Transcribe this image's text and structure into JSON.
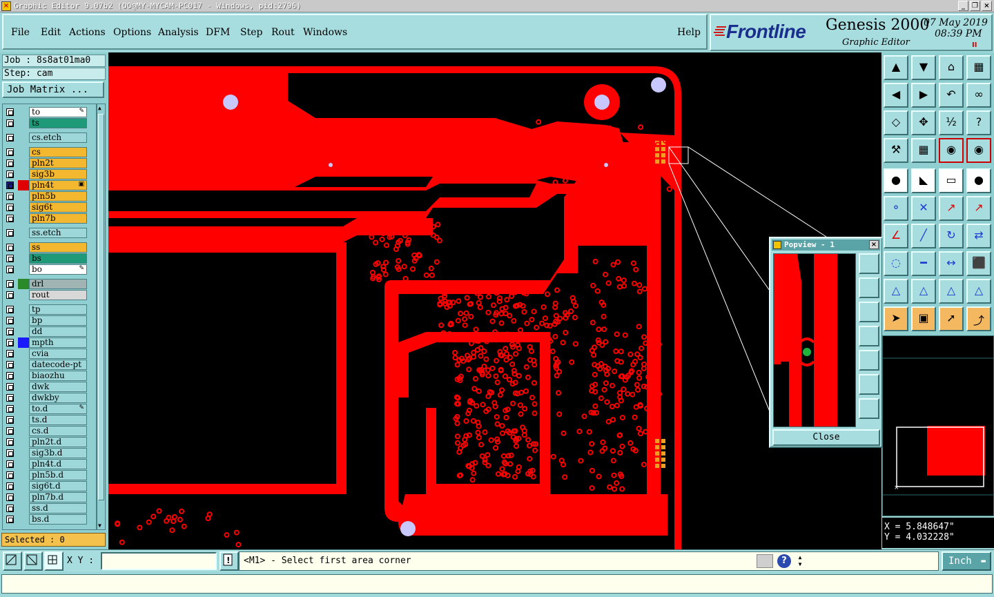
{
  "window": {
    "title": "Graphic Editor 9.07b2 (OO@MY-MYCAM-PC017 - Windows, pid:2796)",
    "min_icon": "minimize-icon",
    "max_icon": "restore-icon",
    "close_icon": "close-icon"
  },
  "menu": {
    "items": [
      {
        "label": "File",
        "key": "F"
      },
      {
        "label": "Edit",
        "key": "E"
      },
      {
        "label": "Actions",
        "key": "A"
      },
      {
        "label": "Options",
        "key": "O"
      },
      {
        "label": "Analysis",
        "key": "n"
      },
      {
        "label": "DFM",
        "key": "D"
      },
      {
        "label": "Step",
        "key": "S"
      },
      {
        "label": "Rout",
        "key": "R"
      },
      {
        "label": "Windows",
        "key": "W"
      }
    ],
    "help": "Help"
  },
  "brand": {
    "logo": "Frontline",
    "product": "Genesis 2000",
    "subtitle": "Graphic Editor",
    "date": "07 May 2019",
    "time": "08:39 PM",
    "pause": "II"
  },
  "job": {
    "job_label": "Job : 8s8at01ma0",
    "step_label": "Step: cam",
    "matrix_button": "Job Matrix ..."
  },
  "layers": [
    {
      "name": "to",
      "color": "#ffffff",
      "swatch": "",
      "mark": "✎",
      "gap_before": false
    },
    {
      "name": "ts",
      "color": "#1e9a78",
      "swatch": "",
      "mark": "",
      "gap_before": false
    },
    {
      "name": "cs.etch",
      "color": "#9ed7d9",
      "swatch": "",
      "mark": "",
      "gap_before": true
    },
    {
      "name": "cs",
      "color": "#f4b830",
      "swatch": "",
      "mark": "",
      "gap_before": true
    },
    {
      "name": "pln2t",
      "color": "#f4b830",
      "swatch": "",
      "mark": "",
      "gap_before": false
    },
    {
      "name": "sig3b",
      "color": "#f4b830",
      "swatch": "",
      "mark": "",
      "gap_before": false
    },
    {
      "name": "pln4t",
      "color": "#f4b830",
      "swatch": "#e00000",
      "mark": "▣",
      "gap_before": false,
      "active": true
    },
    {
      "name": "pln5b",
      "color": "#f4b830",
      "swatch": "",
      "mark": "",
      "gap_before": false
    },
    {
      "name": "sig6t",
      "color": "#f4b830",
      "swatch": "",
      "mark": "",
      "gap_before": false
    },
    {
      "name": "pln7b",
      "color": "#f4b830",
      "swatch": "",
      "mark": "",
      "gap_before": false
    },
    {
      "name": "ss.etch",
      "color": "#9ed7d9",
      "swatch": "",
      "mark": "",
      "gap_before": true
    },
    {
      "name": "ss",
      "color": "#f4b830",
      "swatch": "",
      "mark": "",
      "gap_before": true
    },
    {
      "name": "bs",
      "color": "#1e9a78",
      "swatch": "",
      "mark": "",
      "gap_before": false
    },
    {
      "name": "bo",
      "color": "#ffffff",
      "swatch": "",
      "mark": "✎",
      "gap_before": false
    },
    {
      "name": "drl",
      "color": "#a0b4b4",
      "swatch": "#2a8a2a",
      "mark": "",
      "gap_before": true
    },
    {
      "name": "rout",
      "color": "#d8d8d8",
      "swatch": "",
      "mark": "",
      "gap_before": false
    },
    {
      "name": "tp",
      "color": "#9ed7d9",
      "swatch": "",
      "mark": "",
      "gap_before": true
    },
    {
      "name": "bp",
      "color": "#9ed7d9",
      "swatch": "",
      "mark": "",
      "gap_before": false
    },
    {
      "name": "dd",
      "color": "#9ed7d9",
      "swatch": "",
      "mark": "",
      "gap_before": false
    },
    {
      "name": "mpth",
      "color": "#9ed7d9",
      "swatch": "#1a1aff",
      "mark": "",
      "gap_before": false
    },
    {
      "name": "cvia",
      "color": "#9ed7d9",
      "swatch": "",
      "mark": "",
      "gap_before": false
    },
    {
      "name": "datecode-pt",
      "color": "#9ed7d9",
      "swatch": "",
      "mark": "",
      "gap_before": false
    },
    {
      "name": "biaozhu",
      "color": "#9ed7d9",
      "swatch": "",
      "mark": "",
      "gap_before": false
    },
    {
      "name": "dwk",
      "color": "#9ed7d9",
      "swatch": "",
      "mark": "",
      "gap_before": false
    },
    {
      "name": "dwkby",
      "color": "#9ed7d9",
      "swatch": "",
      "mark": "",
      "gap_before": false
    },
    {
      "name": "to.d",
      "color": "#9ed7d9",
      "swatch": "",
      "mark": "✎",
      "gap_before": false
    },
    {
      "name": "ts.d",
      "color": "#9ed7d9",
      "swatch": "",
      "mark": "",
      "gap_before": false
    },
    {
      "name": "cs.d",
      "color": "#9ed7d9",
      "swatch": "",
      "mark": "",
      "gap_before": false
    },
    {
      "name": "pln2t.d",
      "color": "#9ed7d9",
      "swatch": "",
      "mark": "",
      "gap_before": false
    },
    {
      "name": "sig3b.d",
      "color": "#9ed7d9",
      "swatch": "",
      "mark": "",
      "gap_before": false
    },
    {
      "name": "pln4t.d",
      "color": "#9ed7d9",
      "swatch": "",
      "mark": "",
      "gap_before": false
    },
    {
      "name": "pln5b.d",
      "color": "#9ed7d9",
      "swatch": "",
      "mark": "",
      "gap_before": false
    },
    {
      "name": "sig6t.d",
      "color": "#9ed7d9",
      "swatch": "",
      "mark": "",
      "gap_before": false
    },
    {
      "name": "pln7b.d",
      "color": "#9ed7d9",
      "swatch": "",
      "mark": "",
      "gap_before": false
    },
    {
      "name": "ss.d",
      "color": "#9ed7d9",
      "swatch": "",
      "mark": "",
      "gap_before": false
    },
    {
      "name": "bs.d",
      "color": "#9ed7d9",
      "swatch": "",
      "mark": "",
      "gap_before": false
    }
  ],
  "selected": "Selected : 0",
  "popview": {
    "title": "Popview - 1",
    "close": "Close"
  },
  "coords": {
    "x": "X = 5.848647\"",
    "y": "Y = 4.032228\""
  },
  "status": {
    "xy_label": "X Y :",
    "xy_value": "",
    "message": "<M1> - Select first area corner",
    "units": "Inch"
  },
  "colors": {
    "copper": "#ff0000",
    "pad": "#c8c8ff",
    "panel": "#a8dde0"
  }
}
